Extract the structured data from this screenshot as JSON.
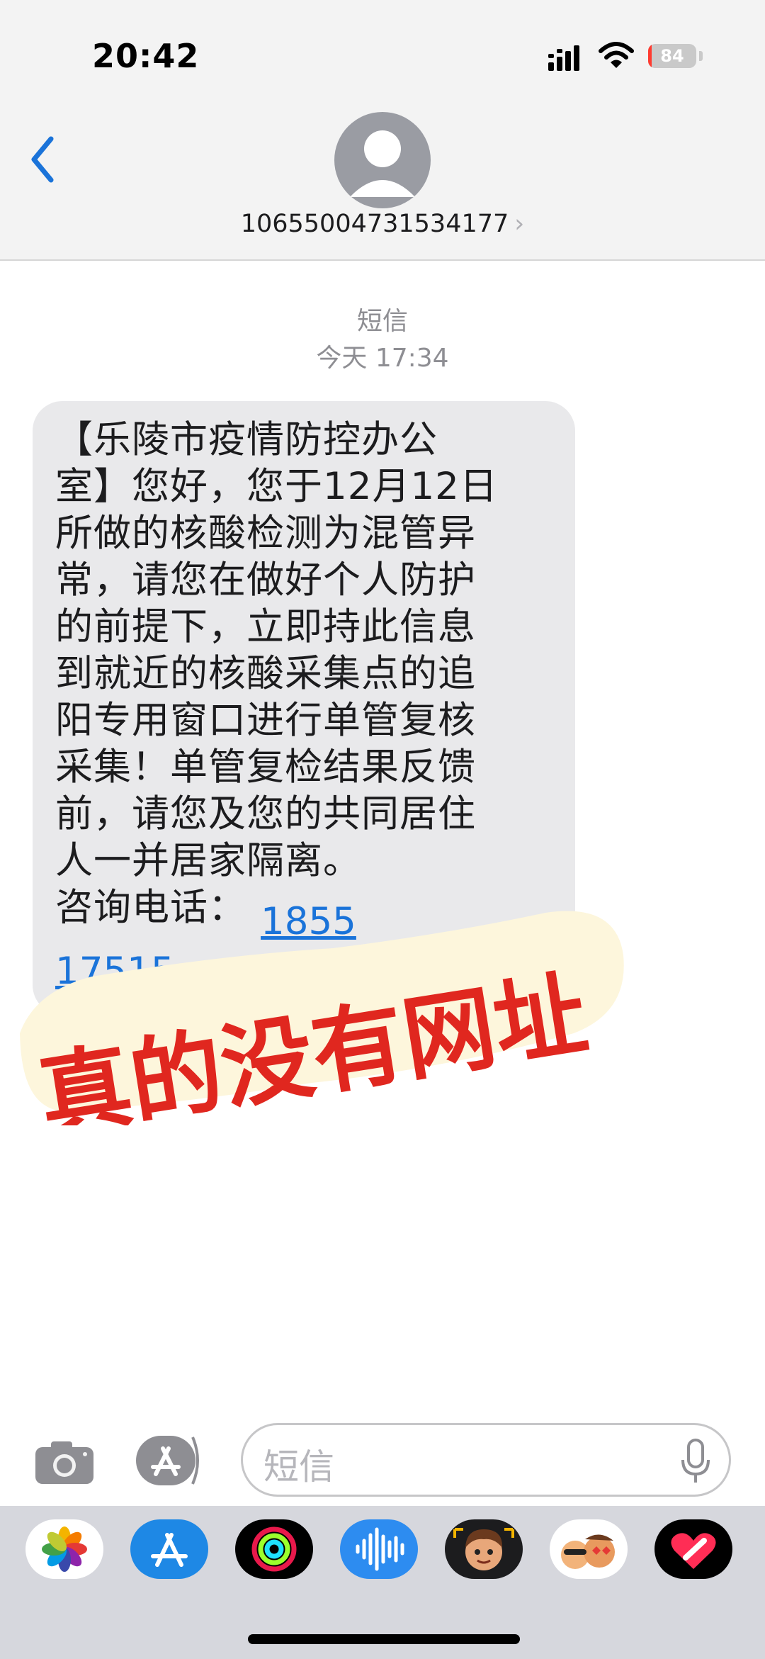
{
  "status_bar": {
    "time": "20:42",
    "battery": "84"
  },
  "header": {
    "contact_number": "10655004731534177",
    "chevron": "›"
  },
  "thread": {
    "service_label": "短信",
    "timestamp": "今天 17:34",
    "message_text": "【乐陵市疫情防控办公\n室】您好，您于12月12日\n所做的核酸检测为混管异\n常，请您在做好个人防护\n的前提下，立即持此信息\n到就近的核酸采集点的追\n阳专用窗口进行单管复核\n采集！单管复检结果反馈\n前，请您及您的共同居住\n人一并居家隔离。\n咨询电话：",
    "phone_1_visible": "1855",
    "phone_2_visible": "17515"
  },
  "overlay": {
    "sticker_text": "真的没有网址",
    "sticker_color": "#e0271f",
    "sticker_bg": "#fdf6dc"
  },
  "composer": {
    "placeholder": "短信"
  },
  "app_drawer": {
    "apps": [
      "photos-icon",
      "app-store-icon",
      "activity-icon",
      "audio-message-icon",
      "memoji-icon",
      "memoji-stickers-icon",
      "digital-touch-icon"
    ]
  },
  "colors": {
    "accent": "#1a73d9",
    "bubble": "#e9e9eb",
    "header_bg": "#f3f3f3"
  }
}
